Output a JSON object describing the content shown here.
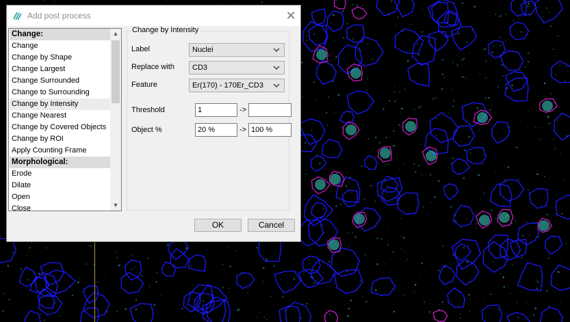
{
  "window": {
    "title": "Add post process",
    "close_glyph": "✕",
    "icon": "app-logo-icon"
  },
  "list": {
    "items": [
      {
        "label": "Change:",
        "type": "header"
      },
      {
        "label": "Change",
        "type": "item"
      },
      {
        "label": "Change by Shape",
        "type": "item"
      },
      {
        "label": "Change Largest",
        "type": "item"
      },
      {
        "label": "Change Surrounded",
        "type": "item"
      },
      {
        "label": "Change to Surrounding",
        "type": "item"
      },
      {
        "label": "Change by Intensity",
        "type": "selected"
      },
      {
        "label": "Change Nearest",
        "type": "item"
      },
      {
        "label": "Change by Covered Objects",
        "type": "item"
      },
      {
        "label": "Change by ROI",
        "type": "item"
      },
      {
        "label": "Apply Counting Frame",
        "type": "item"
      },
      {
        "label": "Morphological:",
        "type": "header"
      },
      {
        "label": "Erode",
        "type": "item"
      },
      {
        "label": "Dilate",
        "type": "item"
      },
      {
        "label": "Open",
        "type": "item"
      },
      {
        "label": "Close",
        "type": "item"
      }
    ],
    "scroll_up": "▲",
    "scroll_down": "▼"
  },
  "panel": {
    "group_title": "Change by Intensity",
    "label": {
      "caption": "Label",
      "value": "Nuclei"
    },
    "replace_with": {
      "caption": "Replace with",
      "value": "CD3"
    },
    "feature": {
      "caption": "Feature",
      "value": "Er(170) - 170Er_CD3"
    },
    "threshold": {
      "caption": "Threshold",
      "from": "1",
      "to": ""
    },
    "object_pct": {
      "caption": "Object %",
      "from": "20 %",
      "to": "100 %"
    },
    "range_arrow": "->"
  },
  "buttons": {
    "ok": "OK",
    "cancel": "Cancel"
  },
  "colors": {
    "outline_blue": "#1a1aff",
    "outline_magenta": "#d61fd6",
    "cell_cyan": "#3fd6c8"
  }
}
